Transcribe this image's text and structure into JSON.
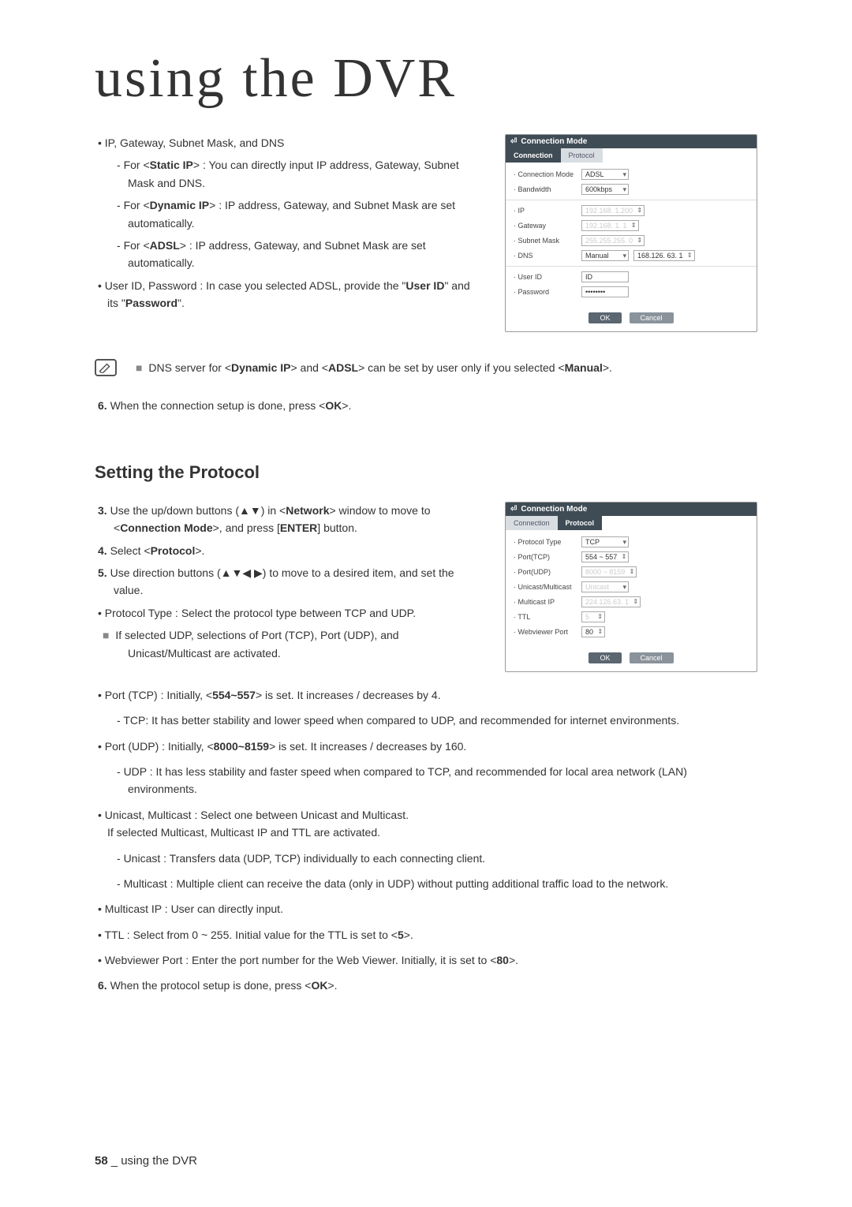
{
  "chapter_title": "using the DVR",
  "section1": {
    "bullets": {
      "ip_gw": "IP, Gateway, Subnet Mask, and DNS",
      "sub_static_pre": "For <",
      "sub_static_tag": "Static IP",
      "sub_static_post": "> : You can directly input IP address, Gateway, Subnet Mask and DNS.",
      "sub_dynamic_pre": "For <",
      "sub_dynamic_tag": "Dynamic IP",
      "sub_dynamic_post": "> : IP address, Gateway, and Subnet Mask are set automatically.",
      "sub_adsl_pre": "For <",
      "sub_adsl_tag": "ADSL",
      "sub_adsl_post": "> : IP address, Gateway, and Subnet Mask are set automatically.",
      "userid_pre": "User ID, Password : In case you selected ADSL, provide the \"",
      "userid_tag": "User ID",
      "userid_mid": "\" and its \"",
      "pw_tag": "Password",
      "userid_post": "\"."
    },
    "note_pre": "DNS server for <",
    "note_dyn": "Dynamic IP",
    "note_mid1": "> and <",
    "note_adsl": "ADSL",
    "note_mid2": "> can be set by user only if you selected <",
    "note_manual": "Manual",
    "note_post": ">.",
    "step6_num": "6.",
    "step6_pre": " When the connection setup is done, press <",
    "step6_ok": "OK",
    "step6_post": ">."
  },
  "shot1": {
    "title": "Connection Mode",
    "tab_connection": "Connection",
    "tab_protocol": "Protocol",
    "connection_mode_label": "Connection Mode",
    "connection_mode_value": "ADSL",
    "bandwidth_label": "Bandwidth",
    "bandwidth_value": "600kbps",
    "ip_label": "IP",
    "ip_value": "192.168. 1.200",
    "gateway_label": "Gateway",
    "gateway_value": "192.168. 1. 1",
    "subnet_label": "Subnet Mask",
    "subnet_value": "255.255.255. 0",
    "dns_label": "DNS",
    "dns_mode": "Manual",
    "dns_value": "168.126. 63. 1",
    "userid_label": "User ID",
    "userid_value": "ID",
    "password_label": "Password",
    "password_value": "••••••••",
    "ok": "OK",
    "cancel": "Cancel"
  },
  "section2": {
    "heading": "Setting the Protocol",
    "step3_num": "3.",
    "step3_pre": " Use the up/down buttons (▲▼) in <",
    "step3_network": "Network",
    "step3_mid": "> window to move to <",
    "step3_conn": "Connection Mode",
    "step3_mid2": ">, and press [",
    "step3_enter": "ENTER",
    "step3_post": "] button.",
    "step4_num": "4.",
    "step4_pre": " Select <",
    "step4_protocol": "Protocol",
    "step4_post": ">.",
    "step5_num": "5.",
    "step5_text": " Use direction buttons (▲▼◀ ▶) to move to a desired item, and set the value.",
    "proto_type": "Protocol Type : Select the protocol type between TCP and UDP.",
    "proto_note": "If selected UDP, selections of Port (TCP), Port (UDP), and Unicast/Multicast are activated.",
    "port_tcp_pre": "Port (TCP) : Initially, <",
    "port_tcp_val": "554~557",
    "port_tcp_post": "> is set. It increases / decreases by 4.",
    "tcp_sub": "TCP: It has better stability and lower speed when compared to UDP, and recommended for internet environments.",
    "port_udp_pre": "Port (UDP) : Initially, <",
    "port_udp_val": "8000~8159",
    "port_udp_post": "> is set. It increases / decreases by 160.",
    "udp_sub": "UDP : It has less stability and faster speed when compared to TCP, and recommended for local area network (LAN) environments.",
    "unicast_line1": "Unicast, Multicast : Select one between Unicast and Multicast.",
    "unicast_line2": "If selected Multicast, Multicast IP and TTL are activated.",
    "uni_sub": "Unicast : Transfers data (UDP, TCP) individually to each connecting client.",
    "multi_sub": "Multicast : Multiple client can receive the data (only in UDP) without putting additional traffic load to the network.",
    "multicast_ip": "Multicast IP : User can directly input.",
    "ttl_pre": "TTL : Select from 0 ~ 255. Initial value for the TTL is set to <",
    "ttl_val": "5",
    "ttl_post": ">.",
    "webviewer_pre": "Webviewer Port : Enter the port number for the Web Viewer. Initially, it is set to <",
    "webviewer_val": "80",
    "webviewer_post": ">.",
    "step6_num": "6.",
    "step6_pre": " When the protocol setup is done, press <",
    "step6_ok": "OK",
    "step6_post": ">."
  },
  "shot2": {
    "title": "Connection Mode",
    "tab_connection": "Connection",
    "tab_protocol": "Protocol",
    "protocol_type_label": "Protocol Type",
    "protocol_type_value": "TCP",
    "port_tcp_label": "Port(TCP)",
    "port_tcp_value": "554 ~ 557",
    "port_udp_label": "Port(UDP)",
    "port_udp_value": "8000 ~ 8159",
    "unicast_label": "Unicast/Multicast",
    "unicast_value": "Unicast",
    "multicast_ip_label": "Multicast IP",
    "multicast_ip_value": "224.126.63. 1",
    "ttl_label": "TTL",
    "ttl_value": "5",
    "webviewer_label": "Webviewer Port",
    "webviewer_value": "80",
    "ok": "OK",
    "cancel": "Cancel"
  },
  "footer": {
    "page_num": "58",
    "sep": "_",
    "running": " using the DVR"
  }
}
